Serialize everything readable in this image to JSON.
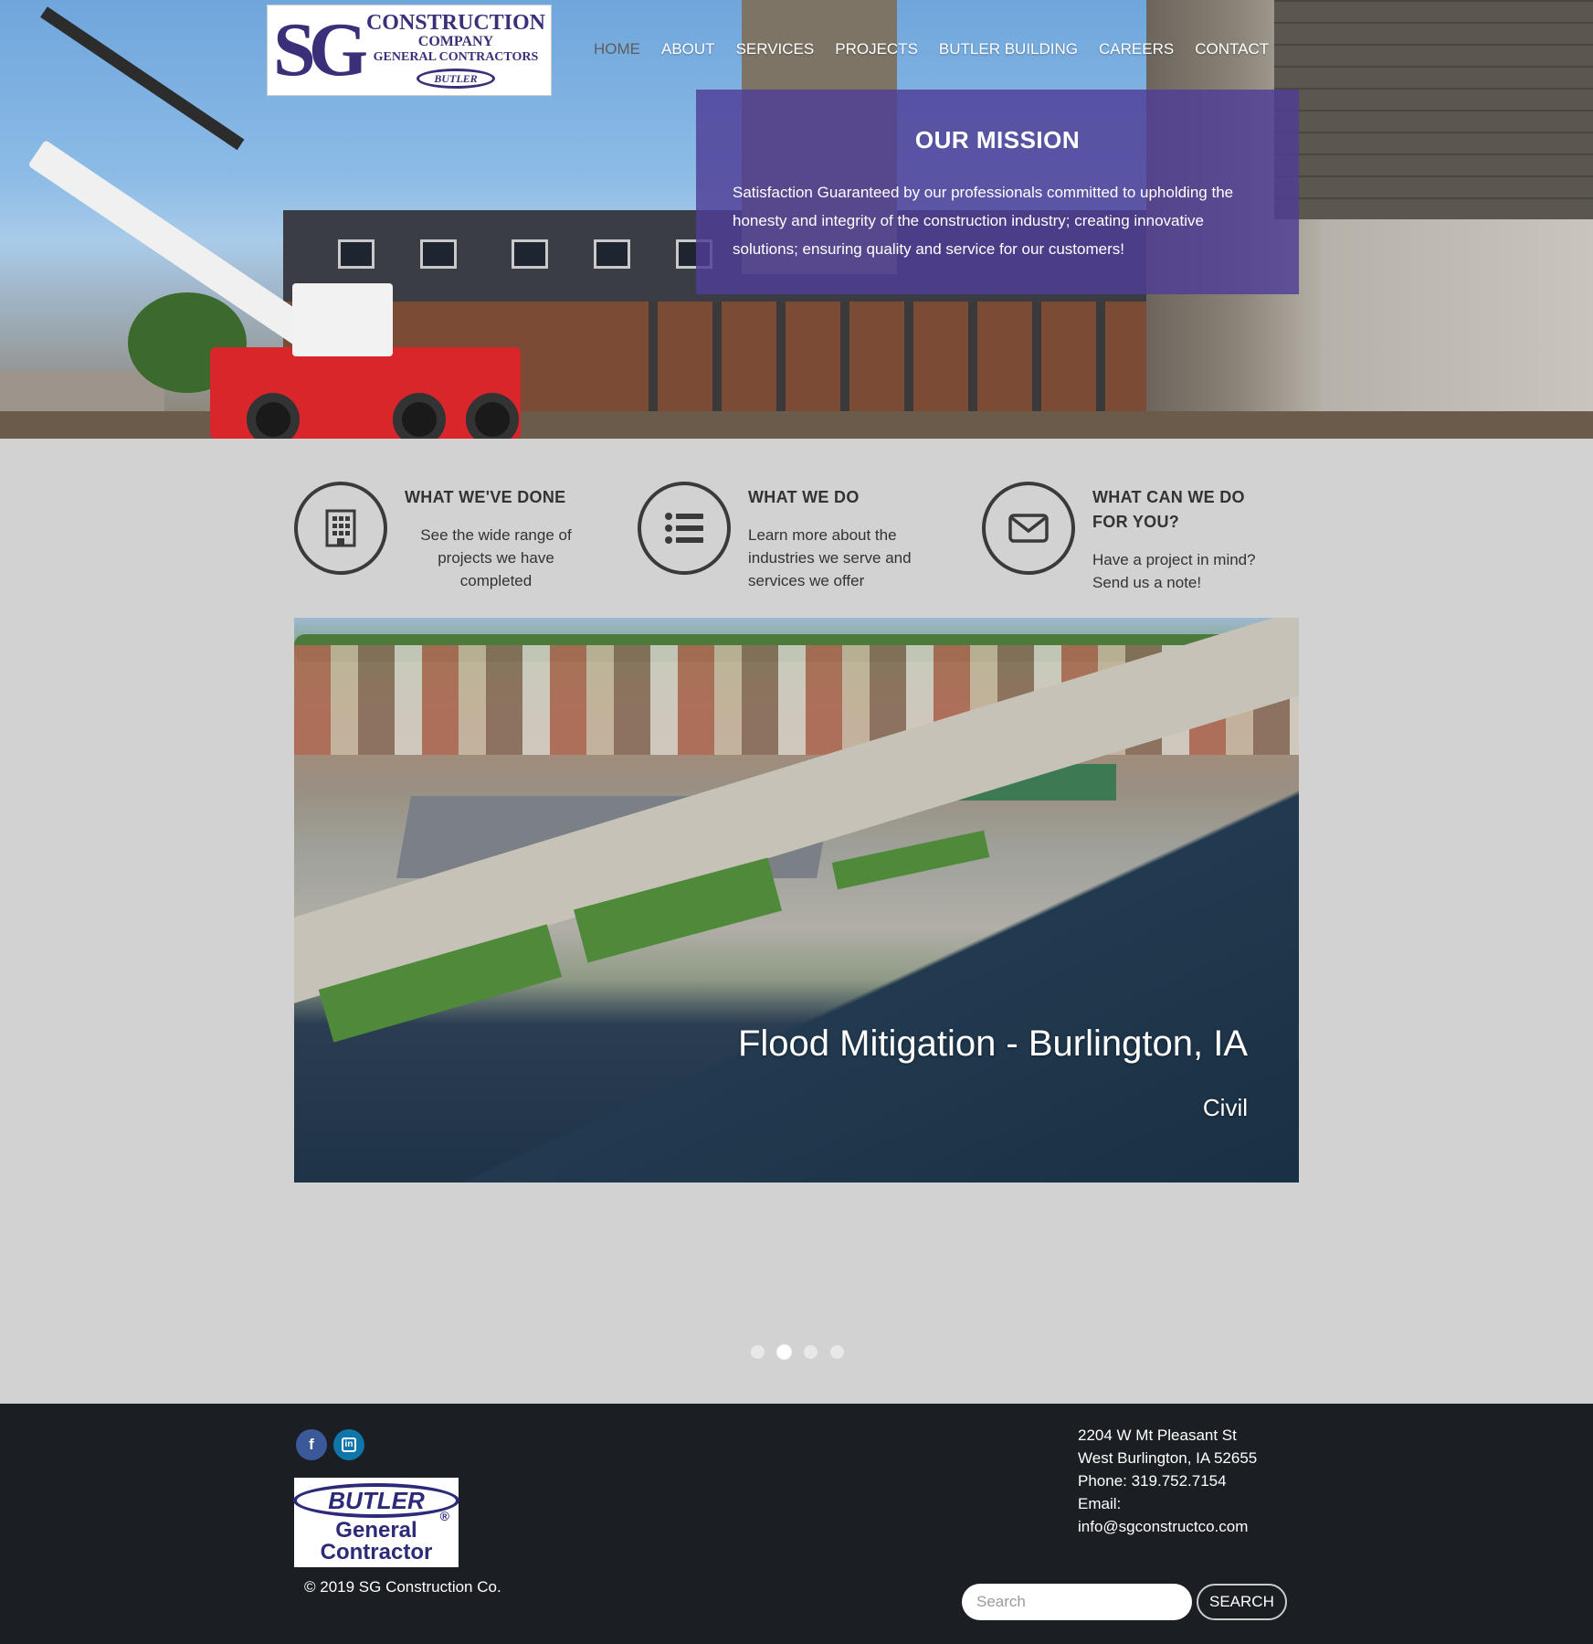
{
  "logo": {
    "mark": "SG",
    "line1": "CONSTRUCTION",
    "line2": "COMPANY",
    "line3": "GENERAL CONTRACTORS",
    "line4": "BUTLER"
  },
  "nav": {
    "items": [
      {
        "label": "HOME",
        "active": true
      },
      {
        "label": "ABOUT"
      },
      {
        "label": "SERVICES"
      },
      {
        "label": "PROJECTS"
      },
      {
        "label": "BUTLER BUILDING"
      },
      {
        "label": "CAREERS"
      },
      {
        "label": "CONTACT"
      }
    ]
  },
  "mission": {
    "title": "OUR MISSION",
    "text": "Satisfaction Guaranteed by our professionals committed to upholding the honesty and integrity of the construction industry; creating innovative solutions; ensuring quality and service for our customers!"
  },
  "features": [
    {
      "icon": "building-icon",
      "title": "WHAT WE'VE DONE",
      "text": "See the wide range of projects we have completed"
    },
    {
      "icon": "list-icon",
      "title": "WHAT WE DO",
      "text": "Learn more about the industries we serve and services we offer"
    },
    {
      "icon": "envelope-icon",
      "title": "WHAT CAN WE DO FOR YOU?",
      "text": "Have a project in mind? Send us a note!"
    }
  ],
  "slider": {
    "title": "Flood Mitigation - Burlington, IA",
    "subtitle": "Civil",
    "slide_count": 4,
    "active_index": 1
  },
  "footer": {
    "social": [
      {
        "icon": "facebook-icon",
        "glyph": "f"
      },
      {
        "icon": "linkedin-icon",
        "glyph": "in"
      }
    ],
    "badge": {
      "line1": "BUTLER",
      "line2": "General",
      "line3": "Contractor",
      "reg": "®"
    },
    "copyright": "© 2019 SG Construction Co.",
    "address_line1": "2204 W Mt Pleasant St",
    "address_line2": "West Burlington, IA 52655",
    "phone": "Phone: 319.752.7154",
    "email_label": "Email:",
    "email": "info@sgconstructco.com",
    "search_placeholder": "Search",
    "search_button": "SEARCH"
  },
  "colors": {
    "brand_purple": "#3b2f7a",
    "mission_bg": "#4f3d96",
    "footer_bg": "#1b1e22",
    "page_bg": "#d2d2d2"
  }
}
